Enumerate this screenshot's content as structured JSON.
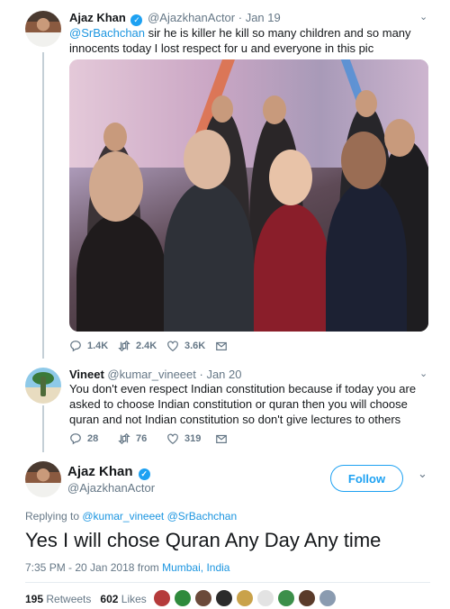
{
  "tweet1": {
    "name": "Ajaz Khan",
    "handle": "@AjazkhanActor",
    "date": "· Jan 19",
    "mention": "@SrBachchan",
    "text": " sir he is killer he kill so many children and so many innocents today I lost respect for u and everyone in this pic",
    "replies": "1.4K",
    "retweets": "2.4K",
    "likes": "3.6K"
  },
  "tweet2": {
    "name": "Vineet",
    "handle": "@kumar_vineeet",
    "date": "· Jan 20",
    "text": "You don't even respect Indian constitution because if today you are asked to choose Indian constitution or quran then you will choose quran and not Indian constitution so don't give lectures to others",
    "replies": "28",
    "retweets": "76",
    "likes": "319"
  },
  "main": {
    "name": "Ajaz Khan",
    "handle": "@AjazkhanActor",
    "follow_label": "Follow",
    "replying_prefix": "Replying to ",
    "replying_to": "@kumar_vineeet @SrBachchan",
    "text": "Yes I will chose Quran Any Day Any time",
    "timestamp": "7:35 PM - 20 Jan 2018 from ",
    "location": "Mumbai, India",
    "retweet_count": "195",
    "retweet_label": " Retweets",
    "like_count": "602",
    "like_label": " Likes"
  },
  "colors": {
    "accent": "#1da1f2",
    "link": "#1b95e0",
    "muted": "#657786"
  },
  "icons": [
    "reply-icon",
    "retweet-icon",
    "like-icon",
    "message-icon",
    "verified-icon",
    "chevron-down-icon"
  ]
}
